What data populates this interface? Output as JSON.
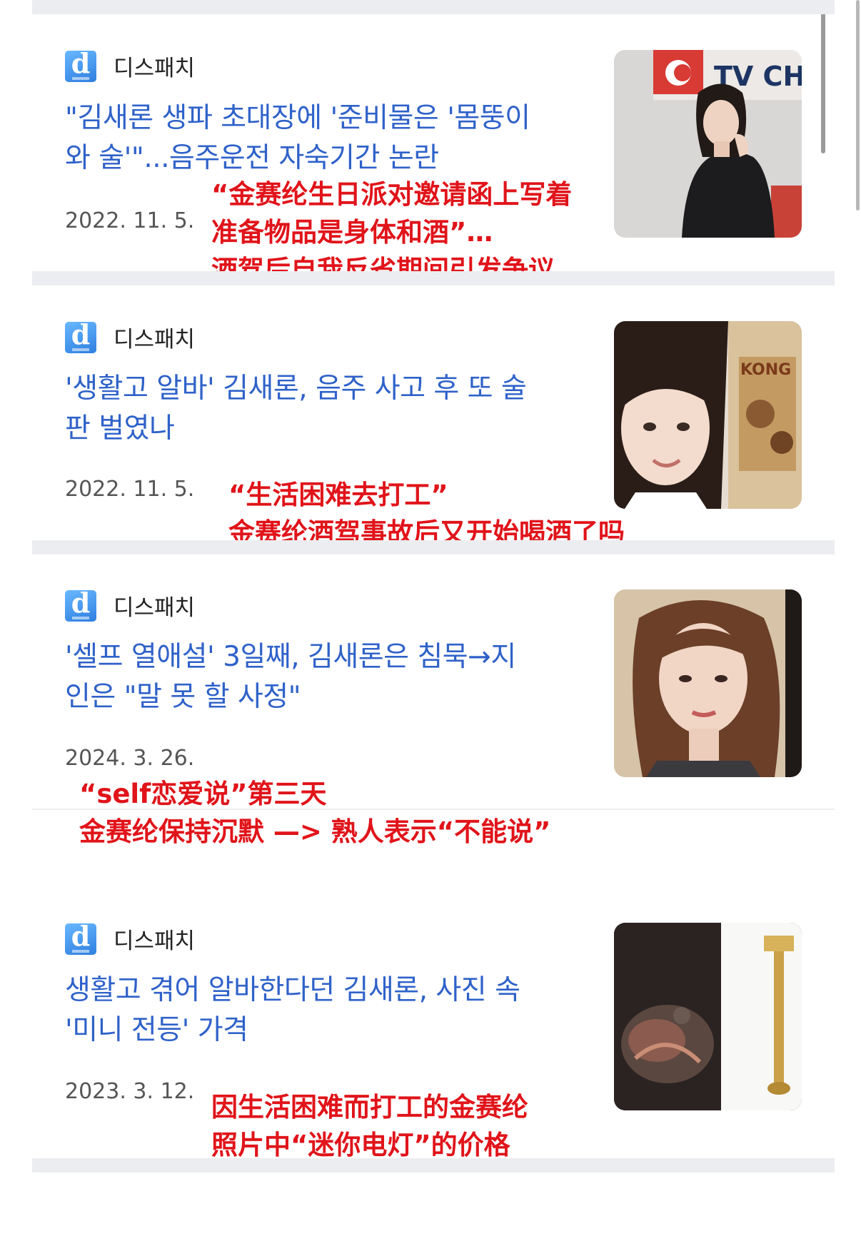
{
  "articles": [
    {
      "source": "디스패치",
      "logo_letter": "d",
      "headline_line1": "\"김새론 생파 초대장에 '준비물은 '몸뚱이",
      "headline_line2": "와 술'\"...음주운전 자숙기간 논란",
      "date": "2022. 11. 5.",
      "annotation": [
        "“金赛纶生日派对邀请函上写着",
        "准备物品是身体和酒”…",
        "酒驾后自我反省期间引发争议"
      ],
      "thumb_text": "TV CHOSUN"
    },
    {
      "source": "디스패치",
      "logo_letter": "d",
      "headline_line1": "'생활고 알바' 김새론, 음주 사고 후 또 술",
      "headline_line2": "판 벌였나",
      "date": "2022. 11. 5.",
      "annotation": [
        "“生活困难去打工”",
        "金赛纶酒驾事故后又开始喝酒了吗"
      ],
      "thumb_text": "KONG"
    },
    {
      "source": "디스패치",
      "logo_letter": "d",
      "headline_line1": "'셀프 열애설' 3일째, 김새론은 침묵→지",
      "headline_line2": "인은 \"말 못 할 사정\"",
      "date": "2024. 3. 26.",
      "annotation": [
        "“self恋爱说”第三天",
        "金赛纶保持沉默 —> 熟人表示“不能说”"
      ]
    },
    {
      "source": "디스패치",
      "logo_letter": "d",
      "headline_line1": "생활고 겪어 알바한다던 김새론, 사진 속",
      "headline_line2": "'미니 전등' 가격",
      "date": "2023. 3. 12.",
      "annotation": [
        "因生活困难而打工的金赛纶",
        "照片中“迷你电灯”的价格"
      ]
    }
  ],
  "colors": {
    "headline": "#2f62c9",
    "annotation": "#e0141a",
    "logo": "#3c8cf0",
    "divider": "#ebedf0"
  }
}
